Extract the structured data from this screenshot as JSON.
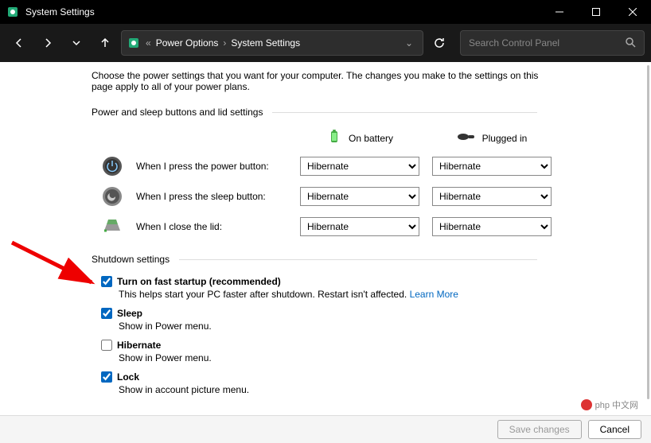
{
  "window": {
    "title": "System Settings",
    "minimize": "—",
    "maximize": "☐",
    "close": "✕"
  },
  "addressbar": {
    "prefix": "«",
    "crumb1": "Power Options",
    "crumb2": "System Settings"
  },
  "search": {
    "placeholder": "Search Control Panel"
  },
  "description": "Choose the power settings that you want for your computer. The changes you make to the settings on this page apply to all of your power plans.",
  "section1_title": "Power and sleep buttons and lid settings",
  "columns": {
    "battery": "On battery",
    "plugged": "Plugged in"
  },
  "rows": [
    {
      "label": "When I press the power button:",
      "battery": "Hibernate",
      "plugged": "Hibernate"
    },
    {
      "label": "When I press the sleep button:",
      "battery": "Hibernate",
      "plugged": "Hibernate"
    },
    {
      "label": "When I close the lid:",
      "battery": "Hibernate",
      "plugged": "Hibernate"
    }
  ],
  "section2_title": "Shutdown settings",
  "shutdown": [
    {
      "checked": true,
      "label": "Turn on fast startup (recommended)",
      "sub": "This helps start your PC faster after shutdown. Restart isn't affected. ",
      "link": "Learn More"
    },
    {
      "checked": true,
      "label": "Sleep",
      "sub": "Show in Power menu."
    },
    {
      "checked": false,
      "label": "Hibernate",
      "sub": "Show in Power menu."
    },
    {
      "checked": true,
      "label": "Lock",
      "sub": "Show in account picture menu."
    }
  ],
  "footer": {
    "save": "Save changes",
    "cancel": "Cancel"
  },
  "watermark": "php 中文网"
}
